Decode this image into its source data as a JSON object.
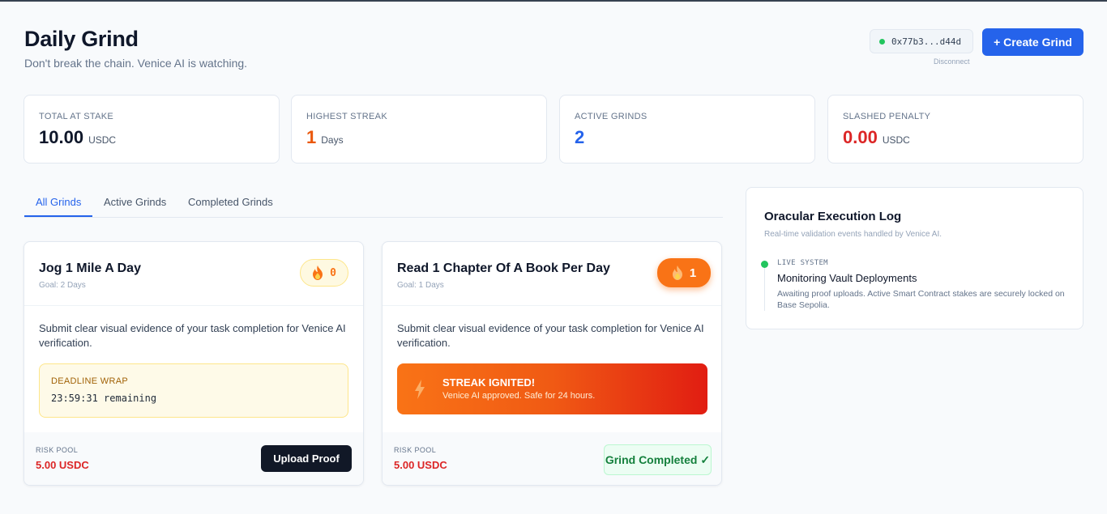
{
  "header": {
    "title": "Daily Grind",
    "subtitle": "Don't break the chain. Venice AI is watching.",
    "wallet_address": "0x77b3...d44d",
    "disconnect_label": "Disconnect",
    "create_button_label": "+ Create Grind"
  },
  "stats": [
    {
      "label": "TOTAL AT STAKE",
      "value": "10.00",
      "unit": "USDC",
      "color": "#0f172a"
    },
    {
      "label": "HIGHEST STREAK",
      "value": "1",
      "unit": "Days",
      "color": "#ea580c"
    },
    {
      "label": "ACTIVE GRINDS",
      "value": "2",
      "unit": "",
      "color": "#2563eb"
    },
    {
      "label": "SLASHED PENALTY",
      "value": "0.00",
      "unit": "USDC",
      "color": "#dc2626"
    }
  ],
  "tabs": [
    {
      "label": "All Grinds",
      "active": true
    },
    {
      "label": "Active Grinds",
      "active": false
    },
    {
      "label": "Completed Grinds",
      "active": false
    }
  ],
  "grinds": [
    {
      "title": "Jog 1 Mile A Day",
      "goal": "Goal: 2 Days",
      "streak": "0",
      "description": "Submit clear visual evidence of your task completion for Venice AI verification.",
      "deadline_label": "DEADLINE WRAP",
      "deadline_value": "23:59:31 remaining",
      "risk_label": "RISK POOL",
      "risk_value": "5.00 USDC",
      "action_label": "Upload Proof"
    },
    {
      "title": "Read 1 Chapter Of A Book Per Day",
      "goal": "Goal: 1 Days",
      "streak": "1",
      "description": "Submit clear visual evidence of your task completion for Venice AI verification.",
      "ignited_title": "STREAK IGNITED!",
      "ignited_subtitle": "Venice AI approved. Safe for 24 hours.",
      "risk_label": "RISK POOL",
      "risk_value": "5.00 USDC",
      "action_label": "Grind Completed",
      "action_check": "✓"
    }
  ],
  "log": {
    "title": "Oracular Execution Log",
    "subtitle": "Real-time validation events handled by Venice AI.",
    "entries": [
      {
        "tag": "LIVE SYSTEM",
        "title": "Monitoring Vault Deployments",
        "description": "Awaiting proof uploads. Active Smart Contract stakes are securely locked on Base Sepolia."
      }
    ]
  },
  "icons": {
    "streak": "flame-icon",
    "ignited": "lightning-bolt-icon",
    "wallet_status": "status-dot-icon",
    "log_entry": "status-dot-icon"
  }
}
